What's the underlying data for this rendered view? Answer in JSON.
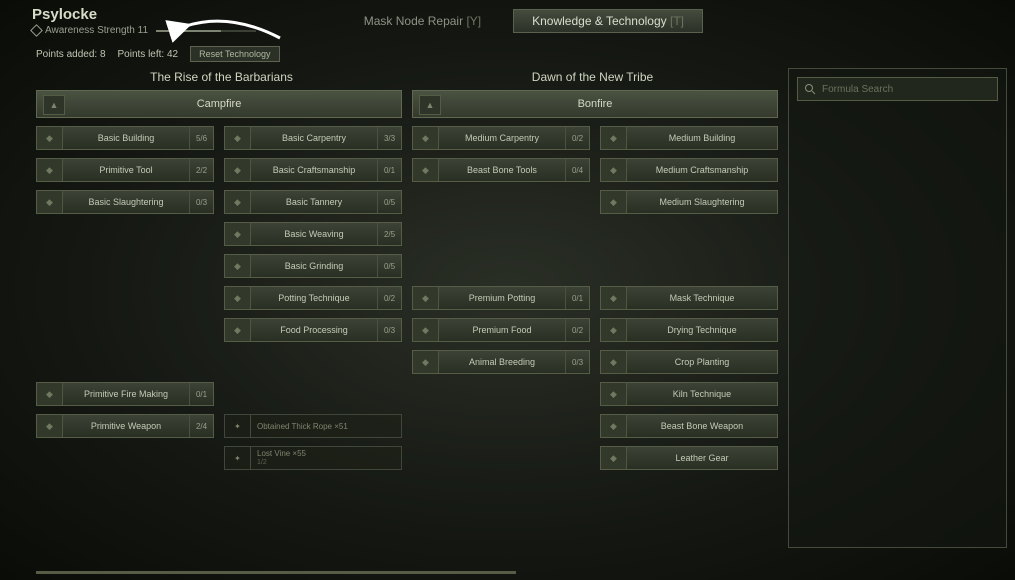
{
  "player": {
    "name": "Psylocke",
    "awareness_label": "Awareness Strength 11"
  },
  "tabs": {
    "mask": {
      "label": "Mask Node Repair",
      "hotkey": "[Y]"
    },
    "tech": {
      "label": "Knowledge & Technology",
      "hotkey": "[T]"
    }
  },
  "stats": {
    "points_added_label": "Points added:",
    "points_added": "8",
    "points_left_label": "Points left:",
    "points_left": "42",
    "reset_label": "Reset Technology"
  },
  "ages": {
    "left": "The Rise of the Barbarians",
    "right": "Dawn of the New Tribe"
  },
  "workbenches": {
    "campfire": "Campfire",
    "bonfire": "Bonfire"
  },
  "search": {
    "placeholder": "Formula Search"
  },
  "grid": [
    [
      {
        "label": "Basic Building",
        "prog": "5/6"
      },
      {
        "label": "Basic Carpentry",
        "prog": "3/3"
      },
      {
        "label": "Medium Carpentry",
        "prog": "0/2"
      },
      {
        "label": "Medium Building",
        "prog": ""
      }
    ],
    [
      {
        "label": "Primitive Tool",
        "prog": "2/2"
      },
      {
        "label": "Basic Craftsmanship",
        "prog": "0/1"
      },
      {
        "label": "Beast Bone Tools",
        "prog": "0/4"
      },
      {
        "label": "Medium Craftsmanship",
        "prog": ""
      }
    ],
    [
      {
        "label": "Basic Slaughtering",
        "prog": "0/3"
      },
      {
        "label": "Basic Tannery",
        "prog": "0/5"
      },
      null,
      {
        "label": "Medium Slaughtering",
        "prog": ""
      }
    ],
    [
      null,
      {
        "label": "Basic Weaving",
        "prog": "2/5"
      },
      null,
      null
    ],
    [
      null,
      {
        "label": "Basic Grinding",
        "prog": "0/5"
      },
      null,
      null
    ],
    [
      null,
      {
        "label": "Potting Technique",
        "prog": "0/2"
      },
      {
        "label": "Premium Potting",
        "prog": "0/1"
      },
      {
        "label": "Mask Technique",
        "prog": ""
      }
    ],
    [
      null,
      {
        "label": "Food Processing",
        "prog": "0/3"
      },
      {
        "label": "Premium Food",
        "prog": "0/2"
      },
      {
        "label": "Drying Technique",
        "prog": ""
      }
    ],
    [
      null,
      null,
      {
        "label": "Animal Breeding",
        "prog": "0/3"
      },
      {
        "label": "Crop Planting",
        "prog": ""
      }
    ],
    [
      {
        "label": "Primitive Fire Making",
        "prog": "0/1"
      },
      null,
      null,
      {
        "label": "Kiln Technique",
        "prog": ""
      }
    ],
    [
      {
        "label": "Primitive Weapon",
        "prog": "2/4"
      },
      {
        "quest": true,
        "label": "Obtained Thick Rope ×51",
        "sub": ""
      },
      null,
      {
        "label": "Beast Bone Weapon",
        "prog": ""
      }
    ],
    [
      null,
      {
        "quest": true,
        "label": "Lost Vine ×55",
        "sub": "1/2"
      },
      null,
      {
        "label": "Leather Gear",
        "prog": ""
      }
    ]
  ]
}
